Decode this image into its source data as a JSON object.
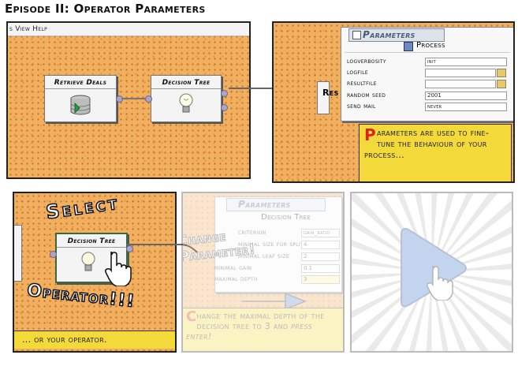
{
  "title": "Episode II: Operator Parameters",
  "panel1": {
    "menu": "s View Help",
    "operators": [
      {
        "label": "Retrieve Deals",
        "icon": "database-icon"
      },
      {
        "label": "Decision Tree",
        "icon": "lightbulb-icon"
      }
    ]
  },
  "panel2": {
    "clipped_label": "Res",
    "window_title": "Parameters",
    "header": "Process",
    "rows": [
      {
        "label": "logverbosity",
        "value": "init",
        "control": "dropdown"
      },
      {
        "label": "logfile",
        "value": "",
        "control": "file"
      },
      {
        "label": "resultfile",
        "value": "",
        "control": "file"
      },
      {
        "label": "random seed",
        "value": "2001",
        "control": "text"
      },
      {
        "label": "send mail",
        "value": "never",
        "control": "dropdown"
      }
    ],
    "caption_initial": "P",
    "caption_rest": "arameters are used to fine-tune the behaviour of your process..."
  },
  "panel3": {
    "shout_top": "Select",
    "shout_bottom": "Operator!!!",
    "operator_label": "Decision Tree",
    "caption": "... or your operator."
  },
  "panel4": {
    "window_title": "Parameters",
    "header": "Decision Tree",
    "rows": [
      {
        "label": "criterion",
        "value": "gain_ratio"
      },
      {
        "label": "minimal size for split",
        "value": "4"
      },
      {
        "label": "minimal leaf size",
        "value": "2"
      },
      {
        "label": "minimal gain",
        "value": "0.1"
      },
      {
        "label": "maximal depth",
        "value": "3"
      }
    ],
    "shout": "Change Parameter!",
    "caption_initial": "C",
    "caption_rest": "hange the maximal depth of the decision tree to 3",
    "caption_end_pre": "and",
    "caption_end_em": "press enter!"
  },
  "colors": {
    "panel_orange": "#f0b060",
    "caption_yellow": "#f4d93b",
    "accent_red": "#d8261e",
    "title_blue": "#4a5a7a"
  }
}
